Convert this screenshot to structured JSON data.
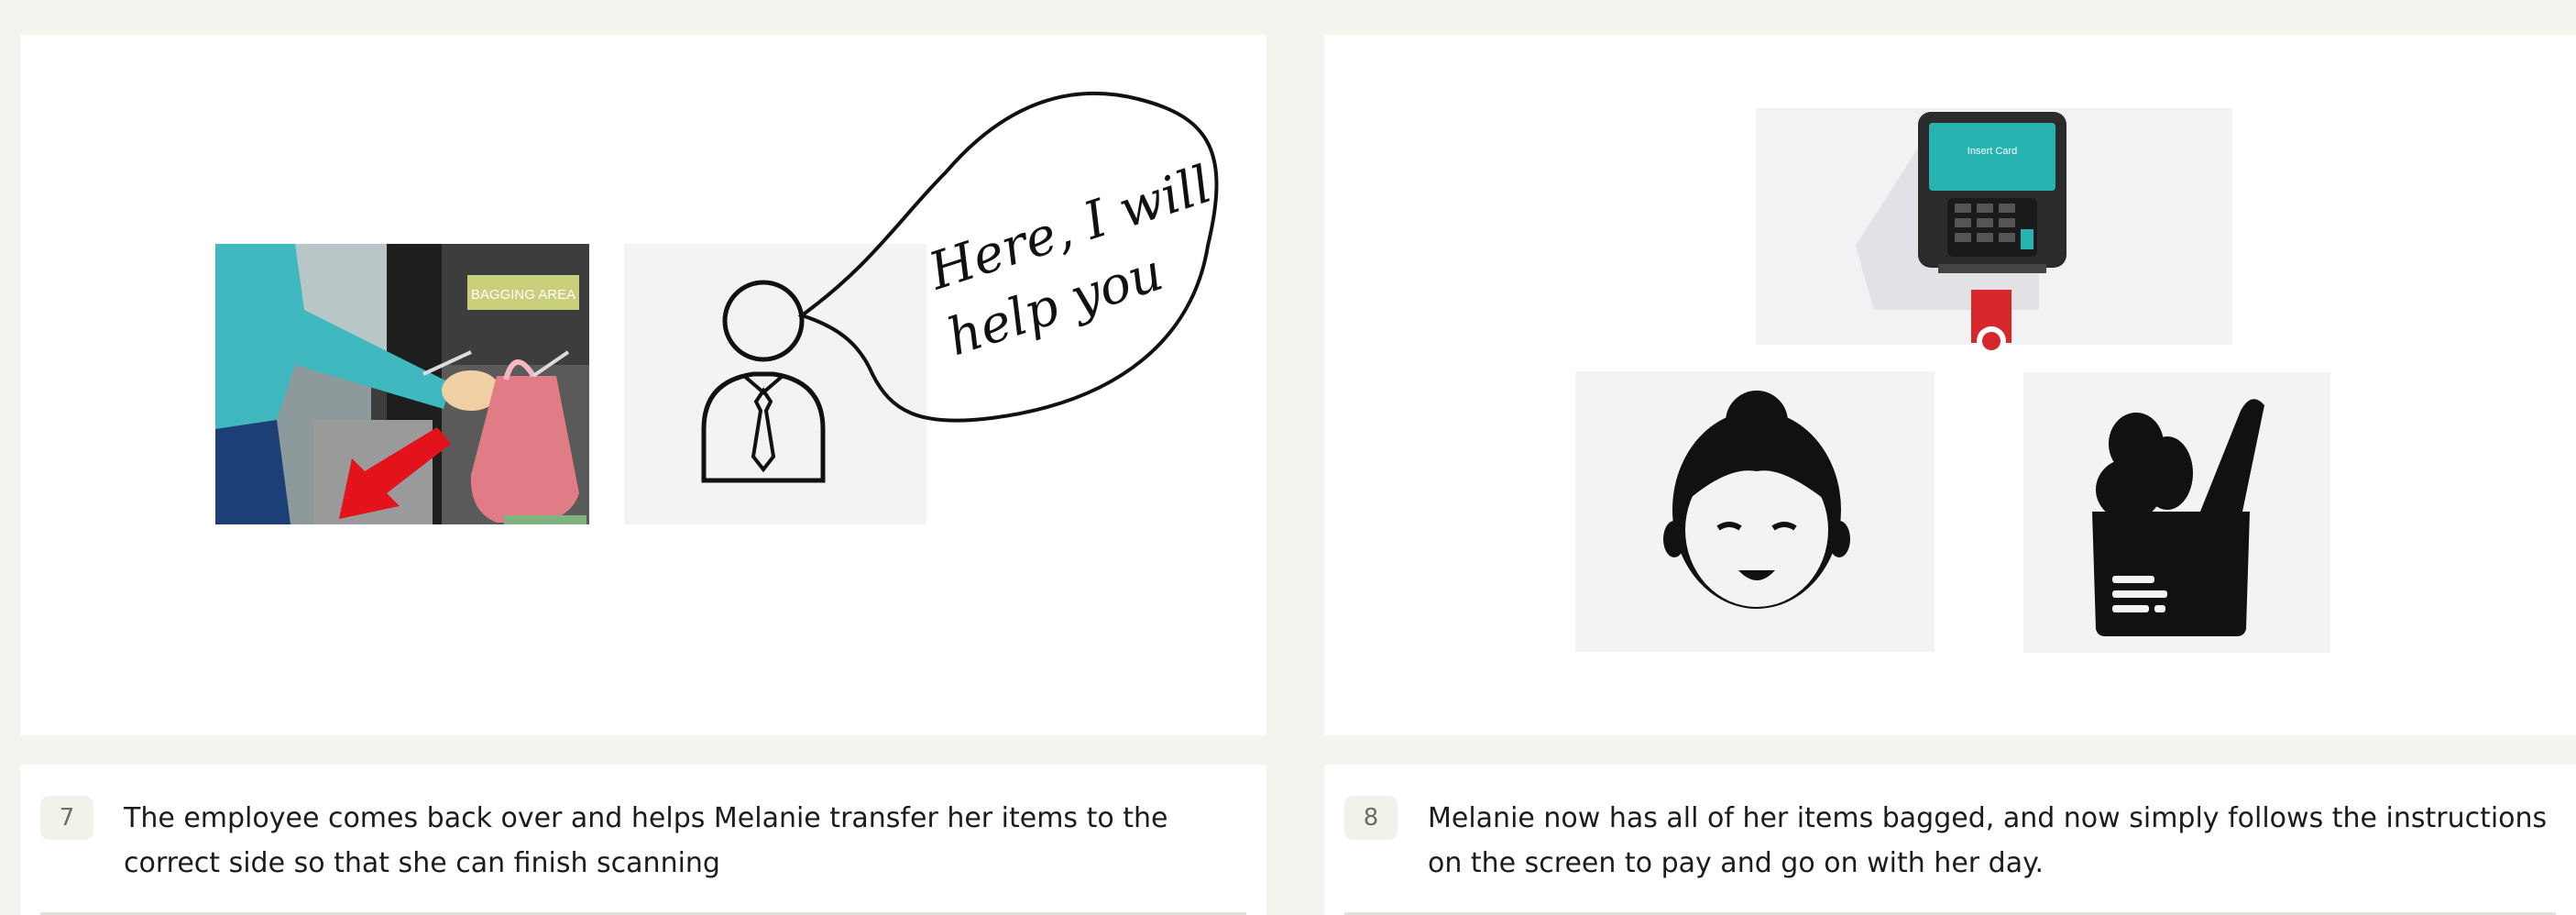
{
  "steps": [
    {
      "number": "7",
      "caption": "The employee comes back over and helps Melanie transfer her items to the correct side so that she can finish scanning",
      "image": {
        "icons": [
          "self-checkout-bagging-photo",
          "employee-icon",
          "speech-bubble-icon"
        ],
        "sign_text": "BAGGING AREA",
        "speech_line1": "Here, I will",
        "speech_line2": "help you"
      }
    },
    {
      "number": "8",
      "caption": "Melanie now has all of her items bagged, and now simply follows the instructions on the screen to pay and go on with her day.",
      "image": {
        "icons": [
          "card-terminal-icon",
          "woman-face-icon",
          "grocery-bag-icon"
        ],
        "terminal_screen_text": "Insert Card"
      }
    }
  ],
  "colors": {
    "page_background": "#f4f4ef",
    "panel_background": "#ffffff",
    "badge_background": "#f1f2ea",
    "shirt_teal": "#3fb8c0",
    "bag_pink": "#e07c86",
    "arrow_red": "#e3121b",
    "terminal_screen": "#27b3b0",
    "card_red": "#d6282b"
  }
}
